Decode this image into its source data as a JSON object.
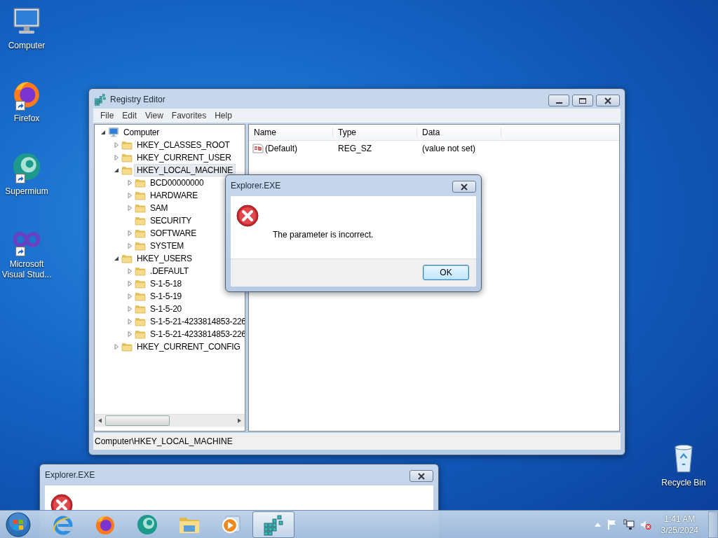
{
  "desktop_icons": [
    {
      "label": "Computer",
      "kind": "computer",
      "shortcut": false
    },
    {
      "label": "Firefox",
      "kind": "firefox",
      "shortcut": true
    },
    {
      "label": "Supermium",
      "kind": "supermium",
      "shortcut": true
    },
    {
      "label": "Microsoft Visual Stud...",
      "kind": "visualstudio",
      "shortcut": true
    }
  ],
  "recycle_bin": {
    "label": "Recycle Bin"
  },
  "registry_editor": {
    "title": "Registry Editor",
    "menu": [
      "File",
      "Edit",
      "View",
      "Favorites",
      "Help"
    ],
    "tree": [
      {
        "label": "Computer",
        "kind": "computer",
        "has_children": true,
        "expanded": true,
        "selected": false,
        "children": [
          {
            "label": "HKEY_CLASSES_ROOT",
            "kind": "folder",
            "has_children": true,
            "expanded": false,
            "selected": false
          },
          {
            "label": "HKEY_CURRENT_USER",
            "kind": "folder",
            "has_children": true,
            "expanded": false,
            "selected": false
          },
          {
            "label": "HKEY_LOCAL_MACHINE",
            "kind": "folder",
            "has_children": true,
            "expanded": true,
            "selected": true,
            "children": [
              {
                "label": "BCD00000000",
                "kind": "folder",
                "has_children": true,
                "expanded": false,
                "selected": false
              },
              {
                "label": "HARDWARE",
                "kind": "folder",
                "has_children": true,
                "expanded": false,
                "selected": false
              },
              {
                "label": "SAM",
                "kind": "folder",
                "has_children": true,
                "expanded": false,
                "selected": false
              },
              {
                "label": "SECURITY",
                "kind": "folder",
                "has_children": false,
                "selected": false
              },
              {
                "label": "SOFTWARE",
                "kind": "folder",
                "has_children": true,
                "expanded": false,
                "selected": false
              },
              {
                "label": "SYSTEM",
                "kind": "folder",
                "has_children": true,
                "expanded": false,
                "selected": false
              }
            ]
          },
          {
            "label": "HKEY_USERS",
            "kind": "folder",
            "has_children": true,
            "expanded": true,
            "selected": false,
            "children": [
              {
                "label": ".DEFAULT",
                "kind": "folder",
                "has_children": true,
                "expanded": false,
                "selected": false
              },
              {
                "label": "S-1-5-18",
                "kind": "folder",
                "has_children": true,
                "expanded": false,
                "selected": false
              },
              {
                "label": "S-1-5-19",
                "kind": "folder",
                "has_children": true,
                "expanded": false,
                "selected": false
              },
              {
                "label": "S-1-5-20",
                "kind": "folder",
                "has_children": true,
                "expanded": false,
                "selected": false
              },
              {
                "label": "S-1-5-21-4233814853-226",
                "kind": "folder",
                "has_children": true,
                "expanded": false,
                "selected": false
              },
              {
                "label": "S-1-5-21-4233814853-226",
                "kind": "folder",
                "has_children": true,
                "expanded": false,
                "selected": false
              }
            ]
          },
          {
            "label": "HKEY_CURRENT_CONFIG",
            "kind": "folder",
            "has_children": true,
            "expanded": false,
            "selected": false
          }
        ]
      }
    ],
    "list": {
      "columns": [
        "Name",
        "Type",
        "Data"
      ],
      "rows": [
        {
          "kind": "string",
          "name": "(Default)",
          "type": "REG_SZ",
          "data": "(value not set)"
        }
      ]
    },
    "status_bar": "Computer\\HKEY_LOCAL_MACHINE"
  },
  "dialogs": [
    {
      "title": "Explorer.EXE",
      "message": "The parameter is incorrect.",
      "button": "OK"
    },
    {
      "title": "Explorer.EXE"
    }
  ],
  "taskbar": {
    "items": [
      {
        "kind": "ie",
        "selected": false
      },
      {
        "kind": "firefox",
        "selected": false
      },
      {
        "kind": "supermium",
        "selected": false
      },
      {
        "kind": "explorer",
        "selected": false
      },
      {
        "kind": "media",
        "selected": false
      },
      {
        "kind": "regedit",
        "selected": true
      }
    ],
    "clock": {
      "time": "1:41 AM",
      "date": "3/25/2024"
    }
  }
}
